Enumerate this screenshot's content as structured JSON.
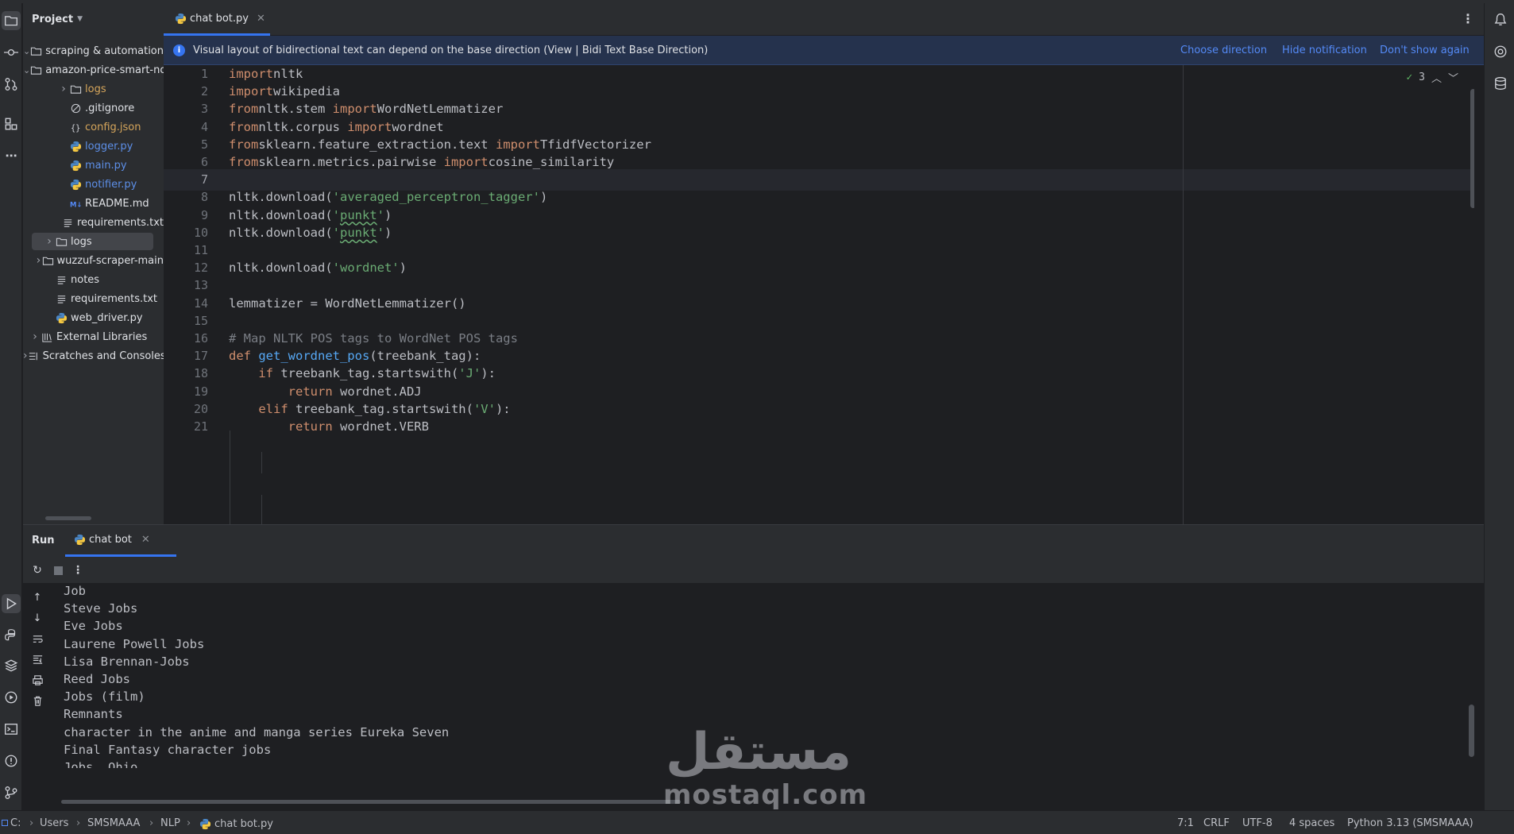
{
  "project_panel": {
    "title": "Project",
    "tree": [
      {
        "label": "scraping & automation",
        "kind": "folder",
        "expanded": true
      },
      {
        "label": "amazon-price-smart-notifier",
        "kind": "folder",
        "expanded": true
      },
      {
        "label": "logs",
        "kind": "folder",
        "expanded": false,
        "color": "orange"
      },
      {
        "label": ".gitignore",
        "kind": "ignore"
      },
      {
        "label": "config.json",
        "kind": "json",
        "color": "orange"
      },
      {
        "label": "logger.py",
        "kind": "python",
        "color": "blue"
      },
      {
        "label": "main.py",
        "kind": "python",
        "color": "blue"
      },
      {
        "label": "notifier.py",
        "kind": "python",
        "color": "blue"
      },
      {
        "label": "README.md",
        "kind": "markdown"
      },
      {
        "label": "requirements.txt",
        "kind": "text"
      },
      {
        "label": "logs",
        "kind": "folder",
        "expanded": false,
        "selected": true
      },
      {
        "label": "wuzzuf-scraper-main",
        "kind": "folder",
        "expanded": false
      },
      {
        "label": "notes",
        "kind": "text"
      },
      {
        "label": "requirements.txt",
        "kind": "text"
      },
      {
        "label": "web_driver.py",
        "kind": "python"
      },
      {
        "label": "External Libraries",
        "kind": "library",
        "expanded": false
      },
      {
        "label": "Scratches and Consoles",
        "kind": "scratch",
        "expanded": false
      }
    ]
  },
  "editor": {
    "tab_label": "chat bot.py",
    "notification": {
      "text": "Visual layout of bidirectional text can depend on the base direction (View | Bidi Text Base Direction)",
      "actions": [
        "Choose direction",
        "Hide notification",
        "Don't show again"
      ]
    },
    "inspection_count": "3",
    "current_line": 7,
    "lines": [
      [
        [
          "kw",
          "import"
        ],
        [
          "",
          "nltk"
        ]
      ],
      [
        [
          "kw",
          "import"
        ],
        [
          "",
          "wikipedia"
        ]
      ],
      [
        [
          "kw",
          "from"
        ],
        [
          "",
          "nltk.stem "
        ],
        [
          "kw",
          "import"
        ],
        [
          "",
          "WordNetLemmatizer"
        ]
      ],
      [
        [
          "kw",
          "from"
        ],
        [
          "",
          "nltk.corpus "
        ],
        [
          "kw",
          "import"
        ],
        [
          "",
          "wordnet"
        ]
      ],
      [
        [
          "kw",
          "from"
        ],
        [
          "",
          "sklearn.feature_extraction.text "
        ],
        [
          "kw",
          "import"
        ],
        [
          "",
          "TfidfVectorizer"
        ]
      ],
      [
        [
          "kw",
          "from"
        ],
        [
          "",
          "sklearn.metrics.pairwise "
        ],
        [
          "kw",
          "import"
        ],
        [
          "",
          "cosine_similarity"
        ]
      ],
      [],
      [
        [
          "",
          "nltk.download("
        ],
        [
          "str",
          "'averaged_perceptron_tagger'"
        ],
        [
          "",
          ")"
        ]
      ],
      [
        [
          "",
          "nltk.download("
        ],
        [
          "str",
          "'"
        ],
        [
          "squig",
          "punkt"
        ],
        [
          "str",
          "'"
        ],
        [
          "",
          ")"
        ]
      ],
      [
        [
          "",
          "nltk.download("
        ],
        [
          "str",
          "'"
        ],
        [
          "squig",
          "punkt"
        ],
        [
          "str",
          "'"
        ],
        [
          "",
          ")"
        ]
      ],
      [],
      [
        [
          "",
          "nltk.download("
        ],
        [
          "str",
          "'wordnet'"
        ],
        [
          "",
          ")"
        ]
      ],
      [],
      [
        [
          "",
          "lemmatizer = WordNetLemmatizer()"
        ]
      ],
      [],
      [
        [
          "cm",
          "# Map NLTK POS tags to WordNet POS tags"
        ]
      ],
      [
        [
          "kw",
          "def "
        ],
        [
          "fn",
          "get_wordnet_pos"
        ],
        [
          "",
          "(treebank_tag):"
        ]
      ],
      [
        [
          "",
          "    "
        ],
        [
          "kw",
          "if"
        ],
        [
          "",
          "",
          " treebank_tag.startswith("
        ],
        [
          "str",
          "'J'"
        ],
        [
          "",
          "):"
        ]
      ],
      [
        [
          "",
          "        "
        ],
        [
          "kw",
          "return"
        ],
        [
          "",
          " wordnet.ADJ"
        ]
      ],
      [
        [
          "",
          "    "
        ],
        [
          "kw",
          "elif"
        ],
        [
          "",
          " treebank_tag.startswith("
        ],
        [
          "str",
          "'V'"
        ],
        [
          "",
          "):"
        ]
      ],
      [
        [
          "",
          "        "
        ],
        [
          "kw",
          "return"
        ],
        [
          "",
          " wordnet.VERB"
        ]
      ]
    ]
  },
  "run_panel": {
    "title": "Run",
    "tab_label": "chat bot",
    "output": [
      "Job",
      "Steve Jobs",
      "Eve Jobs",
      "Laurene Powell Jobs",
      "Lisa Brennan-Jobs",
      "Reed Jobs",
      "Jobs (film)",
      "Remnants",
      "character in the anime and manga series Eureka Seven",
      "Final Fantasy character jobs",
      "Jobs, Ohio"
    ]
  },
  "watermark": {
    "arabic": "مستقل",
    "latin": "mostaql.com"
  },
  "status_bar": {
    "breadcrumbs": [
      "C:",
      "Users",
      "SMSMAAA",
      "NLP",
      "chat bot.py"
    ],
    "position": "7:1",
    "line_ending": "CRLF",
    "encoding": "UTF-8",
    "indent": "4 spaces",
    "interpreter": "Python 3.13 (SMSMAAA)"
  },
  "colors": {
    "accent": "#3574f0",
    "background": "#1e1f22",
    "panel": "#2b2d30",
    "keyword": "#cf8e6d",
    "string": "#6aab73",
    "function": "#56a8f5"
  }
}
